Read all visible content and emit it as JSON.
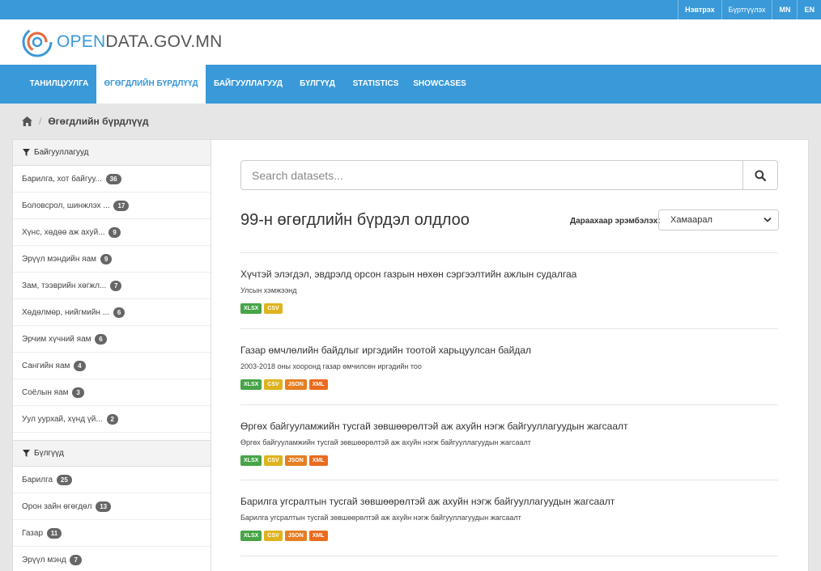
{
  "top_links": [
    {
      "label": "Нэвтрэх",
      "bold": true
    },
    {
      "label": "Бүртгүүлэх",
      "bold": false
    },
    {
      "label": "MN",
      "bold": true
    },
    {
      "label": "EN",
      "bold": true
    }
  ],
  "logo": {
    "part1": "OPEN",
    "part2": "DATA.GOV.MN"
  },
  "nav": [
    {
      "label": "Танилцуулга"
    },
    {
      "label": "Өгөгдлийн бүрдлүүд"
    },
    {
      "label": "Байгууллагууд"
    },
    {
      "label": "Бүлгүүд"
    },
    {
      "label": "Statistics"
    },
    {
      "label": "Showcases"
    }
  ],
  "breadcrumb": {
    "current": "Өгөгдлийн бүрдлүүд"
  },
  "facets": {
    "organizations": {
      "heading": "Байгууллагууд",
      "items": [
        {
          "label": "Барилга, хот байгуу...",
          "count": "36"
        },
        {
          "label": "Боловсрол, шинжлэх ...",
          "count": "17"
        },
        {
          "label": "Хүнс, хөдөө аж ахуй...",
          "count": "9"
        },
        {
          "label": "Эрүүл мэндийн яам",
          "count": "9"
        },
        {
          "label": "Зам, тээврийн хөгжл...",
          "count": "7"
        },
        {
          "label": "Хөдөлмөр, нийгмийн ...",
          "count": "6"
        },
        {
          "label": "Эрчим хүчний яам",
          "count": "6"
        },
        {
          "label": "Сангийн яам",
          "count": "4"
        },
        {
          "label": "Соёлын яам",
          "count": "3"
        },
        {
          "label": "Уул уурхай, хүнд үй...",
          "count": "2"
        }
      ]
    },
    "groups": {
      "heading": "Бүлгүүд",
      "items": [
        {
          "label": "Барилга",
          "count": "25"
        },
        {
          "label": "Орон зайн өгөгдөл",
          "count": "13"
        },
        {
          "label": "Газар",
          "count": "11"
        },
        {
          "label": "Эрүүл мэнд",
          "count": "7"
        }
      ]
    }
  },
  "search": {
    "placeholder": "Search datasets..."
  },
  "results": {
    "count_text": "99-н өгөгдлийн бүрдэл олдлоо"
  },
  "sort": {
    "label": "Дараахаар эрэмбэлэх:",
    "selected": "Хамаарал"
  },
  "datasets": [
    {
      "title": "Хүчтэй элэгдэл, эвдрэлд орсон газрын нөхөн сэргээлтийн ажлын судалгаа",
      "description": "Улсын хэмжээнд",
      "formats": [
        "XLSX",
        "CSV"
      ]
    },
    {
      "title": "Газар өмчлөлийн байдлыг иргэдийн тоотой харьцуулсан байдал",
      "description": "2003-2018 оны хооронд газар өмчилсөн иргэдийн тоо",
      "formats": [
        "XLSX",
        "CSV",
        "JSON",
        "XML"
      ]
    },
    {
      "title": "Өргөх байгууламжийн тусгай зөвшөөрөлтэй аж ахуйн нэгж байгууллагуудын жагсаалт",
      "description": "Өргөх байгууламжийн тусгай зөвшөөрөлтэй аж ахуйн нэгж байгууллагуудын жагсаалт",
      "formats": [
        "XLSX",
        "CSV",
        "JSON",
        "XML"
      ]
    },
    {
      "title": "Барилга угсралтын тусгай зөвшөөрөлтэй аж ахуйн нэгж байгууллагуудын жагсаалт",
      "description": "Барилга угсралтын тусгай зөвшөөрөлтэй аж ахуйн нэгж байгууллагуудын жагсаалт",
      "formats": [
        "XLSX",
        "CSV",
        "JSON",
        "XML"
      ]
    }
  ],
  "colors": {
    "brand": "#3a99d8",
    "xlsx": "#47a447",
    "csv": "#dfb31d",
    "json": "#e67e22",
    "xml": "#ea6b1f"
  },
  "icons": [
    "home-icon",
    "funnel-icon",
    "search-icon",
    "chevron-down-icon",
    "logo-icon"
  ]
}
